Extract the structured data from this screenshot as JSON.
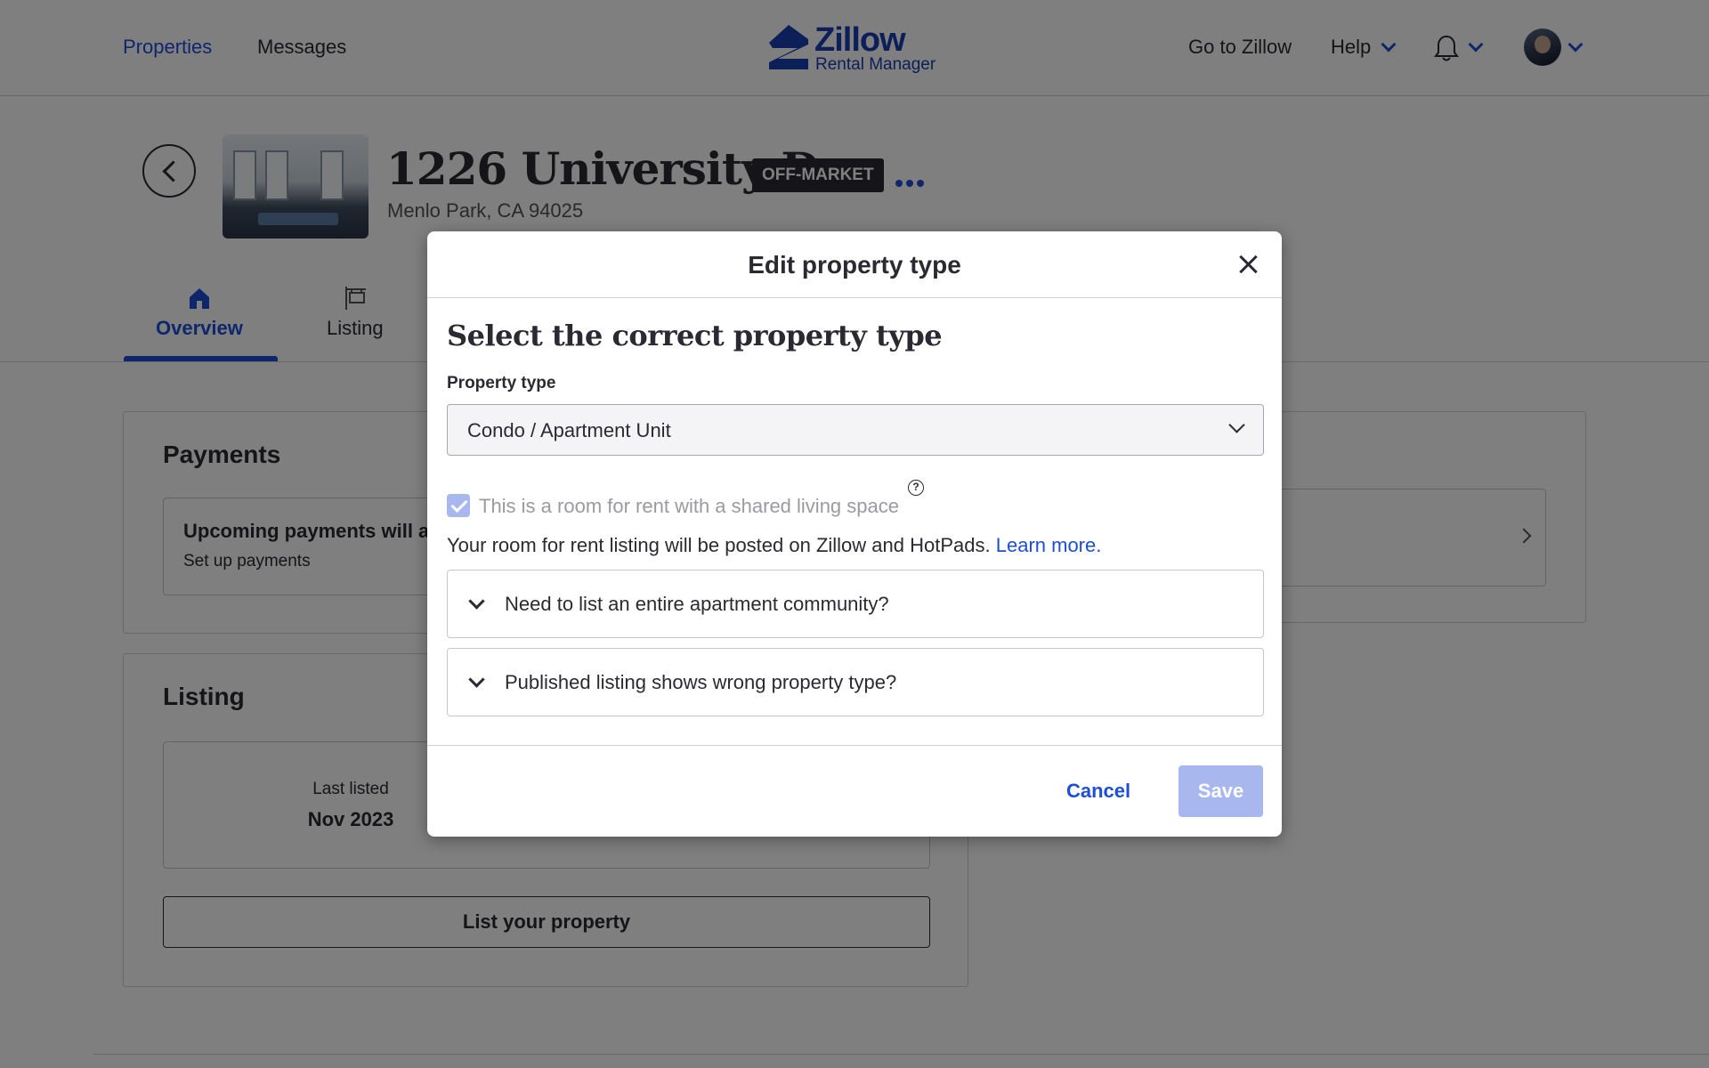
{
  "header": {
    "nav": [
      "Properties",
      "Messages"
    ],
    "logo_word": "Zillow",
    "logo_sub": "Rental Manager",
    "go_to_zillow": "Go to Zillow",
    "help": "Help"
  },
  "property": {
    "address": "1226 University Dr",
    "status": "OFF-MARKET",
    "city": "Menlo Park, CA 94025"
  },
  "tabs": [
    "Overview",
    "Listing"
  ],
  "payments_card": {
    "title": "Payments",
    "item_title": "Upcoming payments will a",
    "item_sub": "Set up payments"
  },
  "listing_card": {
    "title": "Listing",
    "last_listed_label": "Last listed",
    "last_listed_value": "Nov 2023",
    "list_button": "List your property"
  },
  "modal": {
    "title": "Edit property type",
    "subhead": "Select the correct property type",
    "field_label": "Property type",
    "selected_value": "Condo / Apartment Unit",
    "checkbox_label": "This is a room for rent with a shared living space",
    "checkbox_checked": true,
    "help_glyph": "?",
    "info_text": "Your room for rent listing will be posted on Zillow and HotPads.",
    "learn_more": "Learn more.",
    "accordions": [
      "Need to list an entire apartment community?",
      "Published listing shows wrong property type?"
    ],
    "cancel": "Cancel",
    "save": "Save"
  },
  "colors": {
    "accent": "#1d4ed8",
    "badge_bg": "#2a2a33",
    "disabled_save": "#a8b8ee",
    "overlay": "rgba(0,0,0,0.5)"
  }
}
